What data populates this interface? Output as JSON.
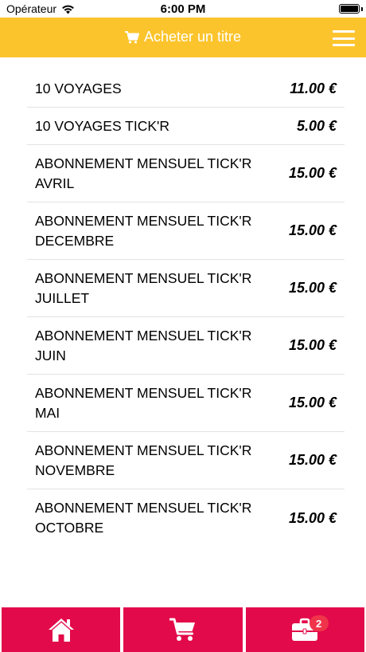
{
  "status_bar": {
    "carrier": "Opérateur",
    "time": "6:00 PM"
  },
  "header": {
    "title": "Acheter un titre",
    "icon": "cart-icon",
    "background_color": "#fcc42c"
  },
  "tickets": [
    {
      "label": "10 VOYAGES",
      "price": "11.00 €"
    },
    {
      "label": "10 VOYAGES TICK'R",
      "price": "5.00 €"
    },
    {
      "label": "ABONNEMENT MENSUEL TICK'R AVRIL",
      "price": "15.00 €"
    },
    {
      "label": "ABONNEMENT MENSUEL TICK'R DECEMBRE",
      "price": "15.00 €"
    },
    {
      "label": "ABONNEMENT MENSUEL TICK'R JUILLET",
      "price": "15.00 €"
    },
    {
      "label": "ABONNEMENT MENSUEL TICK'R JUIN",
      "price": "15.00 €"
    },
    {
      "label": "ABONNEMENT MENSUEL TICK'R MAI",
      "price": "15.00 €"
    },
    {
      "label": "ABONNEMENT MENSUEL TICK'R NOVEMBRE",
      "price": "15.00 €"
    },
    {
      "label": "ABONNEMENT MENSUEL TICK'R OCTOBRE",
      "price": "15.00 €"
    }
  ],
  "tab_bar": {
    "background_color": "#e20a4a",
    "tabs": [
      {
        "icon": "home-icon"
      },
      {
        "icon": "shopping-cart-icon"
      },
      {
        "icon": "briefcase-icon",
        "badge": "2"
      }
    ]
  }
}
